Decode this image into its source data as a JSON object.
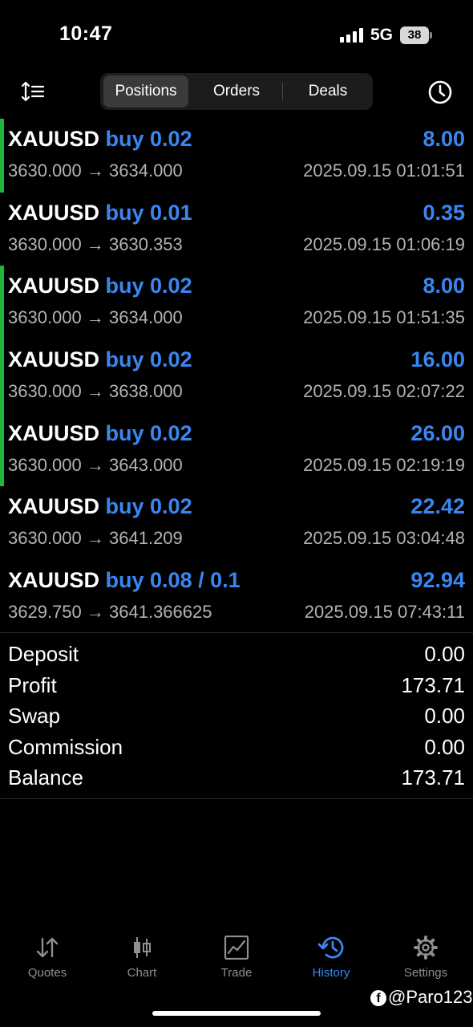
{
  "status": {
    "time": "10:47",
    "network": "5G",
    "battery": "38"
  },
  "tabs": {
    "positions": "Positions",
    "orders": "Orders",
    "deals": "Deals",
    "active": "Positions"
  },
  "positions": [
    {
      "symbol": "XAUUSD",
      "side": "buy 0.02",
      "profit": "8.00",
      "open": "3630.000",
      "arrow": "→",
      "close": "3634.000",
      "time": "2025.09.15 01:01:51",
      "highlight": true
    },
    {
      "symbol": "XAUUSD",
      "side": "buy 0.01",
      "profit": "0.35",
      "open": "3630.000",
      "arrow": "→",
      "close": "3630.353",
      "time": "2025.09.15 01:06:19",
      "highlight": false
    },
    {
      "symbol": "XAUUSD",
      "side": "buy 0.02",
      "profit": "8.00",
      "open": "3630.000",
      "arrow": "→",
      "close": "3634.000",
      "time": "2025.09.15 01:51:35",
      "highlight": true
    },
    {
      "symbol": "XAUUSD",
      "side": "buy 0.02",
      "profit": "16.00",
      "open": "3630.000",
      "arrow": "→",
      "close": "3638.000",
      "time": "2025.09.15 02:07:22",
      "highlight": true
    },
    {
      "symbol": "XAUUSD",
      "side": "buy 0.02",
      "profit": "26.00",
      "open": "3630.000",
      "arrow": "→",
      "close": "3643.000",
      "time": "2025.09.15 02:19:19",
      "highlight": true
    },
    {
      "symbol": "XAUUSD",
      "side": "buy 0.02",
      "profit": "22.42",
      "open": "3630.000",
      "arrow": "→",
      "close": "3641.209",
      "time": "2025.09.15 03:04:48",
      "highlight": false
    },
    {
      "symbol": "XAUUSD",
      "side": "buy 0.08 / 0.1",
      "profit": "92.94",
      "open": "3629.750",
      "arrow": "→",
      "close": "3641.366625",
      "time": "2025.09.15 07:43:11",
      "highlight": false
    }
  ],
  "summary": [
    {
      "label": "Deposit",
      "value": "0.00"
    },
    {
      "label": "Profit",
      "value": "173.71"
    },
    {
      "label": "Swap",
      "value": "0.00"
    },
    {
      "label": "Commission",
      "value": "0.00"
    },
    {
      "label": "Balance",
      "value": "173.71"
    }
  ],
  "tabbar": [
    {
      "label": "Quotes",
      "icon": "arrows-up-down-icon"
    },
    {
      "label": "Chart",
      "icon": "candlestick-icon"
    },
    {
      "label": "Trade",
      "icon": "trade-chart-icon"
    },
    {
      "label": "History",
      "icon": "history-clock-icon",
      "active": true
    },
    {
      "label": "Settings",
      "icon": "gear-icon"
    }
  ],
  "watermark": {
    "handle": "@Paro123",
    "icon": "facebook-icon"
  },
  "colors": {
    "accent": "#3a86f0",
    "profit_bar": "#1fb73a",
    "secondary_text": "#b3b3b3",
    "background": "#000000"
  }
}
